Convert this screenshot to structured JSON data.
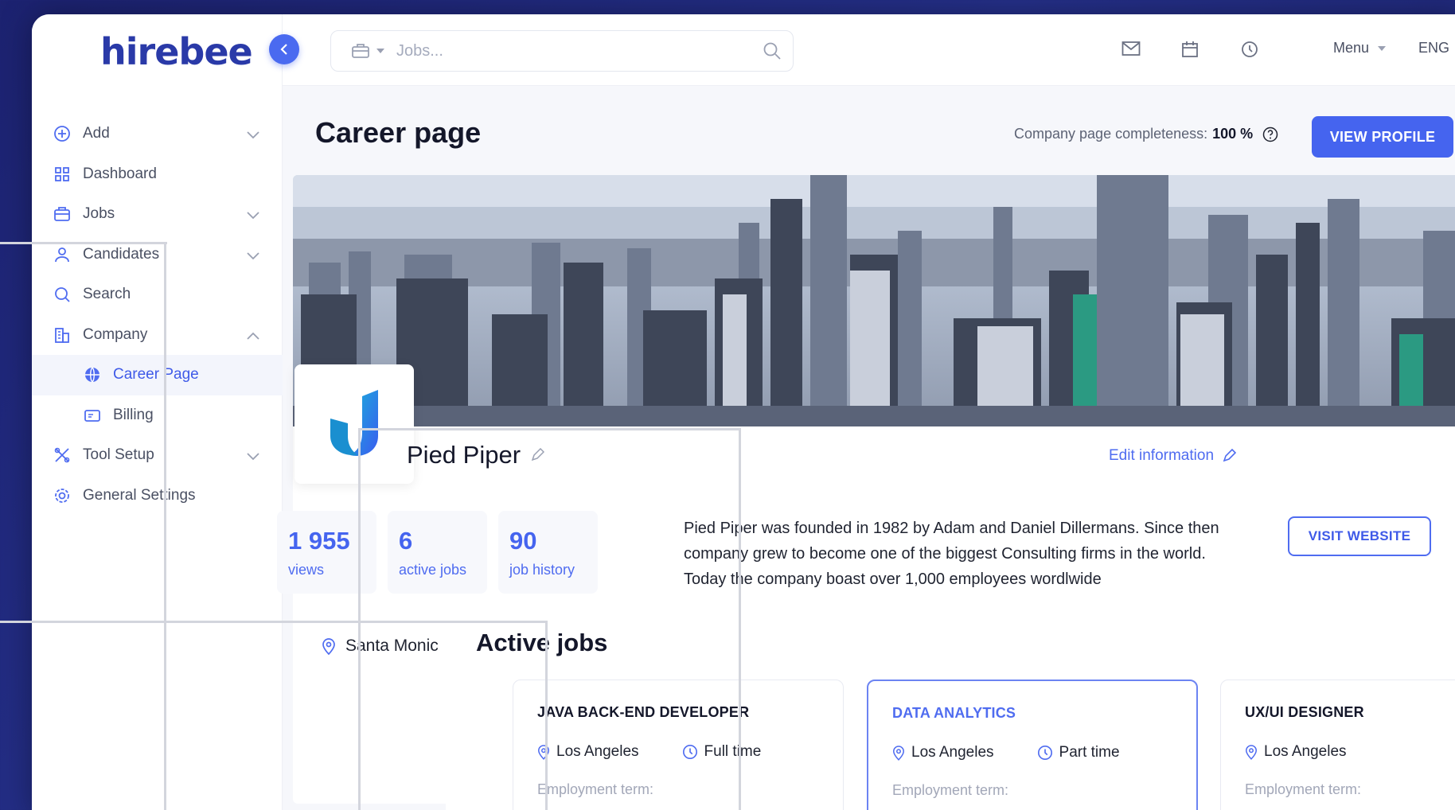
{
  "brand": {
    "logo_text": "hirebee",
    "accent": "#4564ef"
  },
  "sidebar": {
    "items": [
      {
        "label": "Add",
        "icon": "plus-circle-icon"
      },
      {
        "label": "Dashboard",
        "icon": "grid-icon"
      },
      {
        "label": "Jobs",
        "icon": "briefcase-icon"
      },
      {
        "label": "Candidates",
        "icon": "user-icon"
      },
      {
        "label": "Search",
        "icon": "search-icon"
      },
      {
        "label": "Company",
        "icon": "building-icon"
      },
      {
        "label": "Career Page",
        "icon": "globe-icon"
      },
      {
        "label": "Billing",
        "icon": "card-icon"
      },
      {
        "label": "Tool Setup",
        "icon": "tools-icon"
      },
      {
        "label": "General Settings",
        "icon": "gear-icon"
      }
    ]
  },
  "topbar": {
    "search_placeholder": "Jobs...",
    "menu_label": "Menu",
    "lang_label": "ENG"
  },
  "page": {
    "title": "Career page",
    "completeness_label": "Company page completeness:",
    "completeness_value": "100 %",
    "view_profile": "VIEW PROFILE"
  },
  "company": {
    "name": "Pied Piper",
    "edit_info": "Edit information",
    "stats": [
      {
        "value": "1 955",
        "label": "views"
      },
      {
        "value": "6",
        "label": "active jobs"
      },
      {
        "value": "90",
        "label": "job history"
      }
    ],
    "about": "Pied Piper was founded in 1982 by Adam and Daniel Dillermans. Since then company grew to become one of the biggest Consulting firms in the world. Today the company boast over 1,000 employees wordlwide",
    "visit_website": "VISIT WEBSITE",
    "location": "Santa Monic"
  },
  "active_jobs": {
    "title": "Active jobs",
    "jobs": [
      {
        "title": "JAVA BACK-END DEVELOPER",
        "location": "Los Angeles",
        "type": "Full time",
        "term": "Employment term:"
      },
      {
        "title": "DATA ANALYTICS",
        "location": "Los Angeles",
        "type": "Part time",
        "term": "Employment term:"
      },
      {
        "title": "UX/UI DESIGNER",
        "location": "Los Angeles",
        "type": "",
        "term": "Employment term:"
      }
    ]
  }
}
